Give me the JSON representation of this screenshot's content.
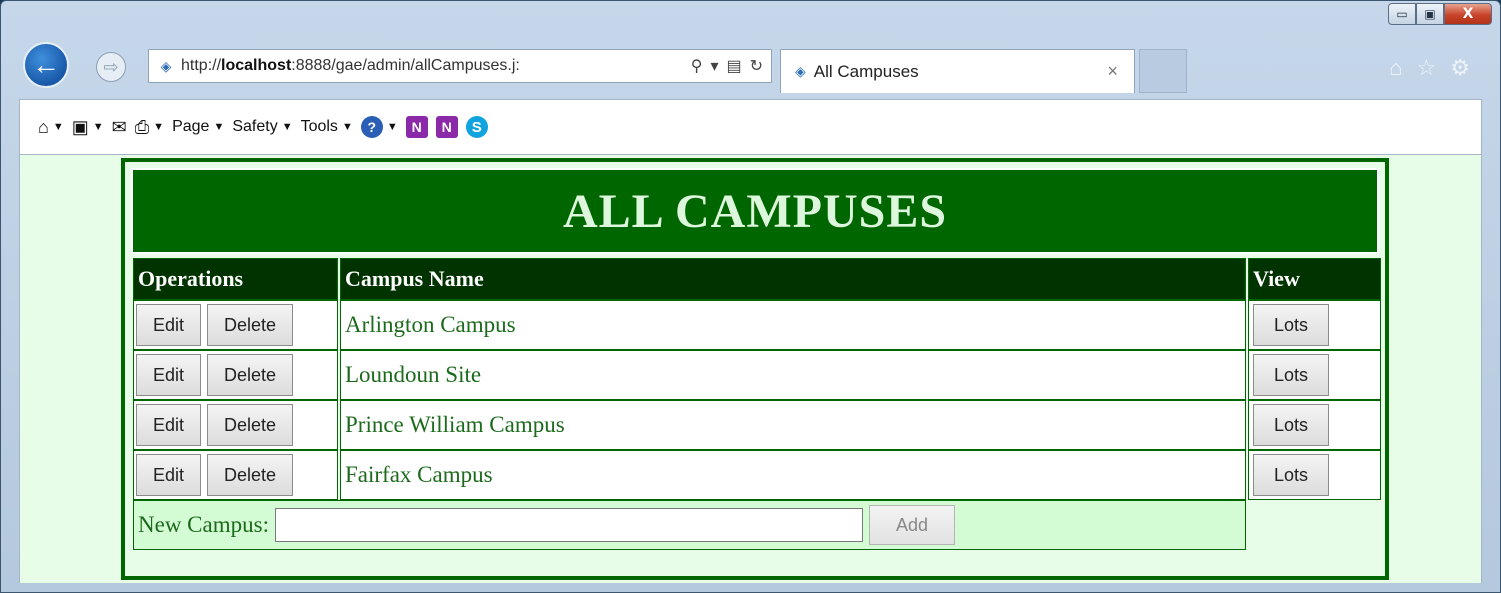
{
  "browser": {
    "url_prefix": "http://",
    "url_host": "localhost",
    "url_rest": ":8888/gae/admin/allCampuses.j:",
    "tab_title": "All Campuses",
    "window_controls": {
      "minimize": "▭",
      "maximize": "▣",
      "close": "X"
    },
    "command_bar": {
      "page": "Page",
      "safety": "Safety",
      "tools": "Tools"
    }
  },
  "page": {
    "title": "ALL CAMPUSES",
    "columns": [
      "Operations",
      "Campus Name",
      "View"
    ],
    "edit_label": "Edit",
    "delete_label": "Delete",
    "view_label": "Lots",
    "rows": [
      {
        "name": "Arlington Campus"
      },
      {
        "name": "Loundoun Site"
      },
      {
        "name": "Prince William Campus"
      },
      {
        "name": "Fairfax Campus"
      }
    ],
    "new_campus_label": "New Campus:",
    "new_campus_value": "",
    "add_label": "Add"
  },
  "colors": {
    "banner": "#006600",
    "header": "#003300",
    "page_bg": "#e7fde7",
    "campus_text": "#1c6a1c"
  }
}
